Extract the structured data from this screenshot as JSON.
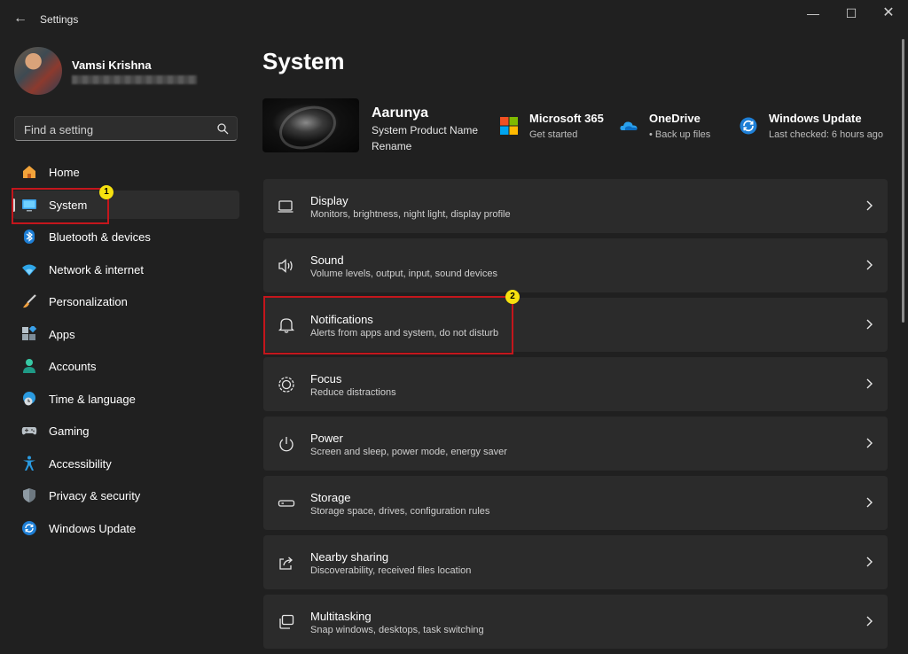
{
  "window": {
    "title": "Settings",
    "back_glyph": "←",
    "minimize_glyph": "—",
    "maximize_glyph": "☐",
    "close_glyph": "✕"
  },
  "profile": {
    "name": "Vamsi Krishna",
    "email_redacted": true
  },
  "search": {
    "placeholder": "Find a setting",
    "value": ""
  },
  "sidebar": {
    "items": [
      {
        "label": "Home",
        "icon": "home-icon",
        "active": false
      },
      {
        "label": "System",
        "icon": "monitor-icon",
        "active": true
      },
      {
        "label": "Bluetooth & devices",
        "icon": "bluetooth-icon",
        "active": false
      },
      {
        "label": "Network & internet",
        "icon": "wifi-icon",
        "active": false
      },
      {
        "label": "Personalization",
        "icon": "brush-icon",
        "active": false
      },
      {
        "label": "Apps",
        "icon": "apps-icon",
        "active": false
      },
      {
        "label": "Accounts",
        "icon": "person-icon",
        "active": false
      },
      {
        "label": "Time & language",
        "icon": "globe-clock-icon",
        "active": false
      },
      {
        "label": "Gaming",
        "icon": "gamepad-icon",
        "active": false
      },
      {
        "label": "Accessibility",
        "icon": "accessibility-icon",
        "active": false
      },
      {
        "label": "Privacy & security",
        "icon": "shield-icon",
        "active": false
      },
      {
        "label": "Windows Update",
        "icon": "update-icon",
        "active": false
      }
    ]
  },
  "annotations": {
    "badge1": "1",
    "badge2": "2",
    "highlight_color": "#c4161c",
    "badge_color": "#f6e10f"
  },
  "main": {
    "title": "System",
    "device": {
      "name": "Aarunya",
      "model": "System Product Name",
      "rename_label": "Rename"
    },
    "quick_links": [
      {
        "title": "Microsoft 365",
        "subtitle": "Get started",
        "icon": "microsoft-365-icon"
      },
      {
        "title": "OneDrive",
        "subtitle": "• Back up files",
        "icon": "onedrive-icon"
      },
      {
        "title": "Windows Update",
        "subtitle": "Last checked: 6 hours ago",
        "icon": "windows-update-icon"
      }
    ],
    "cards": [
      {
        "title": "Display",
        "subtitle": "Monitors, brightness, night light, display profile",
        "icon": "display-icon"
      },
      {
        "title": "Sound",
        "subtitle": "Volume levels, output, input, sound devices",
        "icon": "speaker-icon"
      },
      {
        "title": "Notifications",
        "subtitle": "Alerts from apps and system, do not disturb",
        "icon": "bell-icon"
      },
      {
        "title": "Focus",
        "subtitle": "Reduce distractions",
        "icon": "focus-icon"
      },
      {
        "title": "Power",
        "subtitle": "Screen and sleep, power mode, energy saver",
        "icon": "power-icon"
      },
      {
        "title": "Storage",
        "subtitle": "Storage space, drives, configuration rules",
        "icon": "storage-icon"
      },
      {
        "title": "Nearby sharing",
        "subtitle": "Discoverability, received files location",
        "icon": "share-icon"
      },
      {
        "title": "Multitasking",
        "subtitle": "Snap windows, desktops, task switching",
        "icon": "multitasking-icon"
      }
    ]
  },
  "colors": {
    "background": "#202020",
    "card": "#2b2b2b",
    "accent": "#4cc2ff"
  }
}
